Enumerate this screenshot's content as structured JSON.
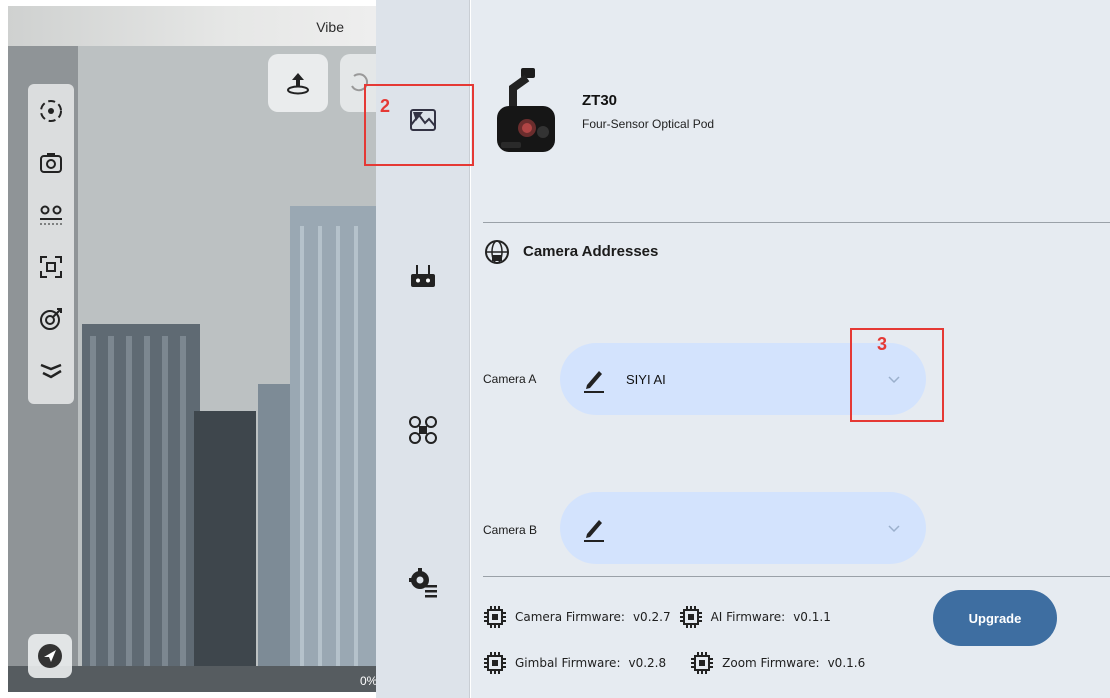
{
  "preview": {
    "app_title": "Vibe",
    "zoom_readout": "0%",
    "tools": [
      "gimbal-center-icon",
      "camera-switch-icon",
      "waypoint-icon",
      "frame-select-icon",
      "target-lock-icon",
      "flight-path-icon"
    ],
    "bottom_button": "send-icon",
    "top_buttons": [
      "upload-icon",
      "rotate-icon"
    ]
  },
  "nav": {
    "items": [
      {
        "icon": "camera-settings-icon",
        "selected": true
      },
      {
        "icon": "remote-controller-icon",
        "selected": false
      },
      {
        "icon": "drone-icon",
        "selected": false
      },
      {
        "icon": "system-settings-icon",
        "selected": false
      }
    ]
  },
  "product": {
    "name": "ZT30",
    "subtitle": "Four-Sensor Optical Pod"
  },
  "section": {
    "title": "Camera Addresses",
    "icon": "network-globe-icon"
  },
  "cameras": [
    {
      "label": "Camera A",
      "value": "SIYI AI"
    },
    {
      "label": "Camera B",
      "value": ""
    }
  ],
  "firmware": {
    "camera_label": "Camera Firmware:",
    "camera_version": "v0.2.7",
    "ai_label": "AI Firmware:",
    "ai_version": "v0.1.1",
    "gimbal_label": "Gimbal Firmware:",
    "gimbal_version": "v0.2.8",
    "zoom_label": "Zoom Firmware:",
    "zoom_version": "v0.1.6",
    "upgrade_label": "Upgrade"
  },
  "annotations": {
    "step2": "2",
    "step3": "3"
  },
  "colors": {
    "accent": "#3e6ea1",
    "select_bg": "#d3e3fd",
    "nav_bg": "#dde3ea",
    "panel_bg": "#e6ebf1",
    "annotation": "#e53935"
  }
}
